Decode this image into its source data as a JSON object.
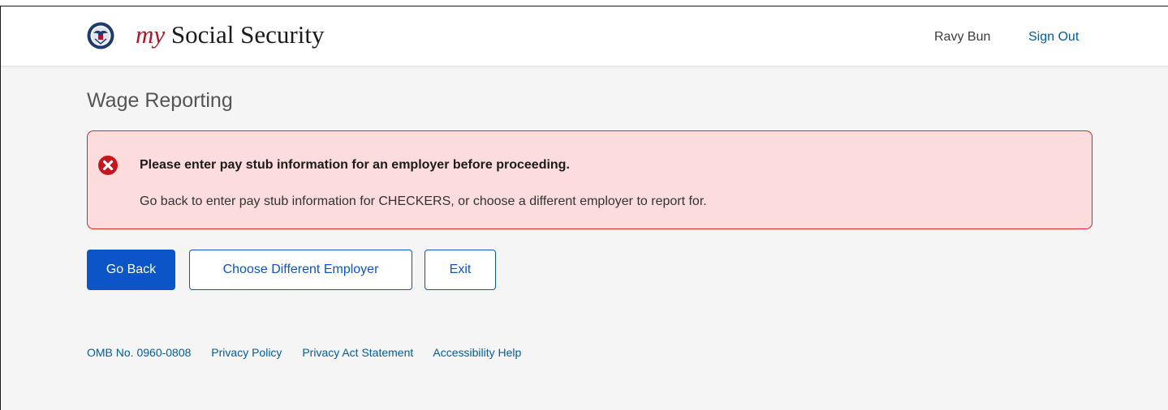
{
  "header": {
    "brand_my": "my",
    "brand_rest": " Social Security",
    "user_name": "Ravy Bun",
    "sign_out_label": "Sign Out",
    "seal_icon": "ssa-seal-icon"
  },
  "main": {
    "page_title": "Wage Reporting",
    "alert": {
      "icon": "error-x-icon",
      "heading": "Please enter pay stub information for an employer before proceeding.",
      "body": "Go back to enter pay stub information for CHECKERS, or choose a different employer to report for."
    },
    "buttons": {
      "go_back": "Go Back",
      "choose_employer": "Choose Different Employer",
      "exit": "Exit"
    }
  },
  "footer": {
    "omb": "OMB No. 0960-0808",
    "links": [
      "Privacy Policy",
      "Privacy Act Statement",
      "Accessibility Help"
    ]
  },
  "colors": {
    "brand_red": "#b01624",
    "primary_blue": "#0b55c9",
    "link_blue": "#005ea2",
    "alert_bg": "#fcdcdc",
    "alert_border": "#d8232a",
    "page_bg": "#f5f5f5"
  }
}
